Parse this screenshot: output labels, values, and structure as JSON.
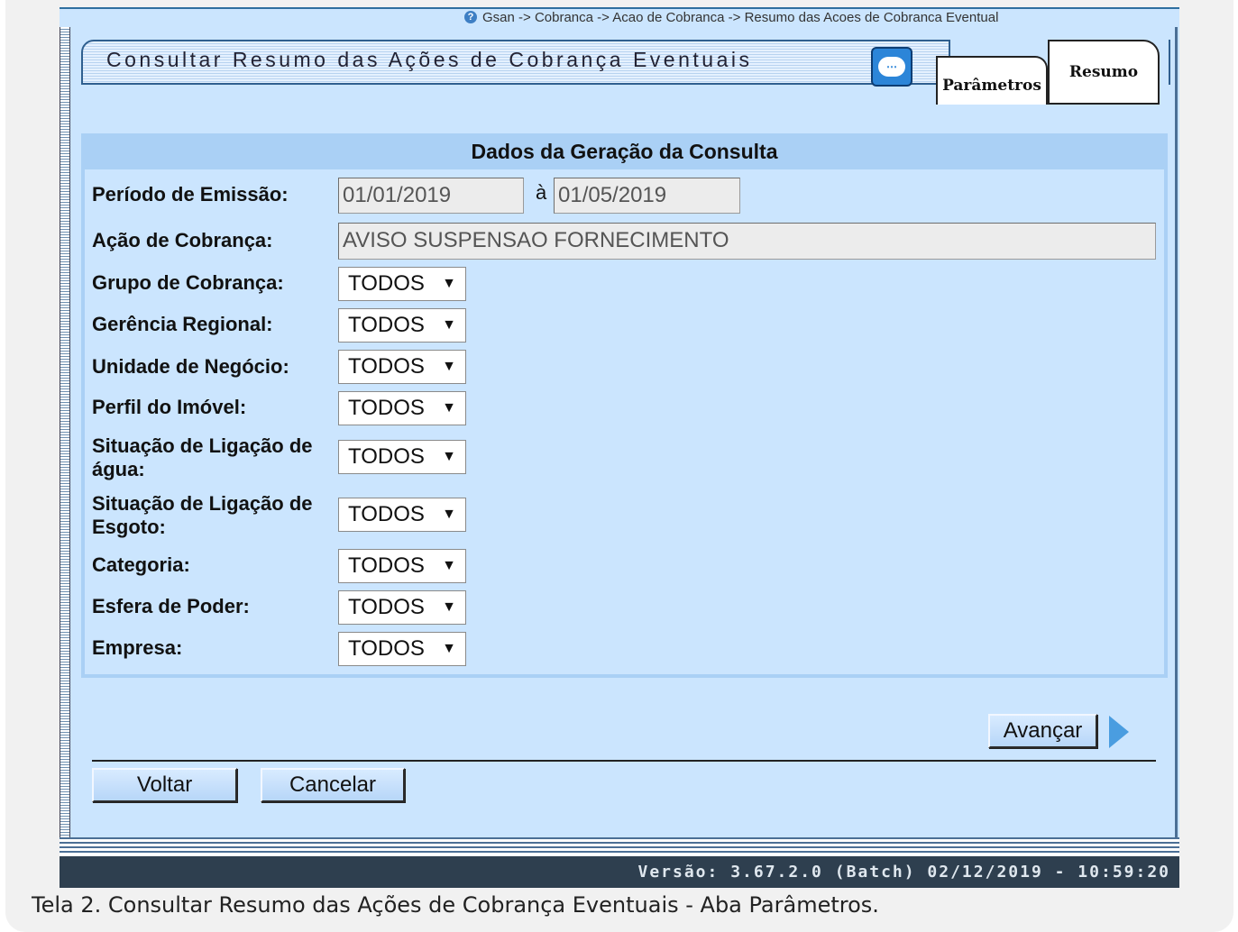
{
  "breadcrumb": "Gsan -> Cobranca -> Acao de Cobranca -> Resumo das Acoes de Cobranca Eventual",
  "window_title": "Consultar Resumo das Ações de Cobrança Eventuais",
  "tabs": [
    {
      "label": "Parâmetros",
      "active": true
    },
    {
      "label": "Resumo",
      "active": false
    }
  ],
  "form": {
    "header": "Dados da Geração da Consulta",
    "periodo": {
      "label": "Período de Emissão:",
      "from": "01/01/2019",
      "separator": "à",
      "to": "01/05/2019"
    },
    "acao": {
      "label": "Ação de Cobrança:",
      "value": "AVISO SUSPENSAO FORNECIMENTO"
    },
    "selects": [
      {
        "label": "Grupo de Cobrança:",
        "value": "TODOS"
      },
      {
        "label": "Gerência Regional:",
        "value": "TODOS"
      },
      {
        "label": "Unidade de Negócio:",
        "value": "TODOS"
      },
      {
        "label": "Perfil do Imóvel:",
        "value": "TODOS"
      },
      {
        "label": "Situação de Ligação de água:",
        "value": "TODOS"
      },
      {
        "label": "Situação de Ligação de Esgoto:",
        "value": "TODOS"
      },
      {
        "label": "Categoria:",
        "value": "TODOS"
      },
      {
        "label": "Esfera de Poder:",
        "value": "TODOS"
      },
      {
        "label": "Empresa:",
        "value": "TODOS"
      }
    ]
  },
  "buttons": {
    "avancar": "Avançar",
    "voltar": "Voltar",
    "cancelar": "Cancelar"
  },
  "footer": "Versão: 3.67.2.0 (Batch) 02/12/2019 - 10:59:20",
  "caption": "Tela 2. Consultar Resumo das Ações de Cobrança Eventuais - Aba Parâmetros.",
  "colors": {
    "panel": "#cbe5fe",
    "header": "#aad0f5",
    "footer": "#2e3f4f"
  },
  "icons": [
    "help-icon",
    "chat-icon",
    "next-arrow-icon",
    "dropdown-arrow-icon"
  ]
}
